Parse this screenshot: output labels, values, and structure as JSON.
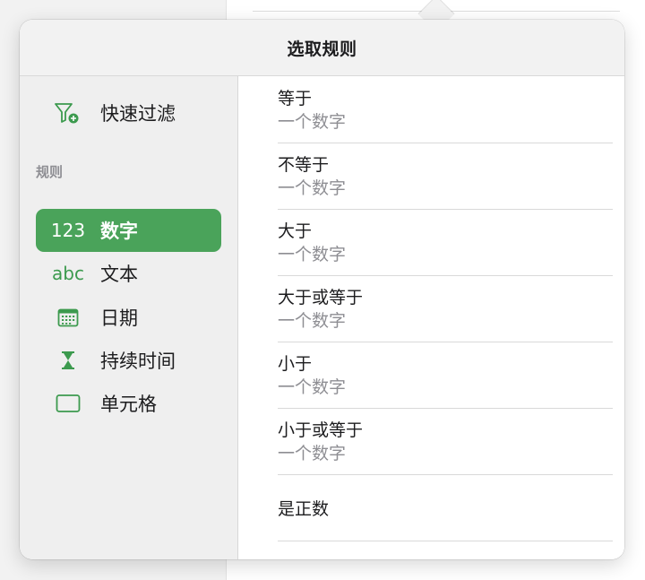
{
  "popover": {
    "title": "选取规则"
  },
  "sidebar": {
    "quick_filter": {
      "label": "快速过滤",
      "icon": "filter-plus-icon"
    },
    "section_label": "规则",
    "rules": [
      {
        "icon_text": "123",
        "label": "数字",
        "selected": true
      },
      {
        "icon_text": "abc",
        "label": "文本",
        "selected": false
      },
      {
        "icon_text": "",
        "icon": "calendar-icon",
        "label": "日期",
        "selected": false
      },
      {
        "icon_text": "",
        "icon": "hourglass-icon",
        "label": "持续时间",
        "selected": false
      },
      {
        "icon_text": "",
        "icon": "cell-icon",
        "label": "单元格",
        "selected": false
      }
    ]
  },
  "conditions": [
    {
      "title": "等于",
      "subtitle": "一个数字"
    },
    {
      "title": "不等于",
      "subtitle": "一个数字"
    },
    {
      "title": "大于",
      "subtitle": "一个数字"
    },
    {
      "title": "大于或等于",
      "subtitle": "一个数字"
    },
    {
      "title": "小于",
      "subtitle": "一个数字"
    },
    {
      "title": "小于或等于",
      "subtitle": "一个数字"
    },
    {
      "title": "是正数",
      "subtitle": ""
    }
  ],
  "colors": {
    "accent": "#4aa35a",
    "icon": "#3c9a4e"
  }
}
